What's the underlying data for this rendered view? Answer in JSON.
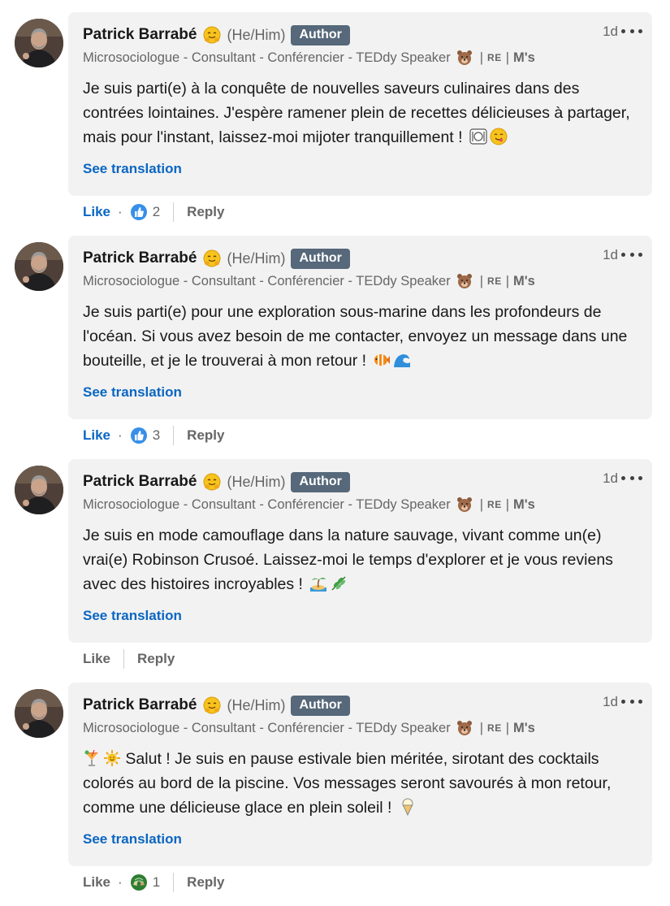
{
  "labels": {
    "author_badge": "Author",
    "see_translation": "See translation",
    "like": "Like",
    "reply": "Reply",
    "separator_dot": "·"
  },
  "colors": {
    "link_blue": "#0a66c2",
    "author_badge_bg": "#56687a",
    "bubble_bg": "#f2f2f2",
    "meta_gray": "#666666"
  },
  "comments": [
    {
      "author": "Patrick Barrabé",
      "author_emoji": "hugging-face-emoji",
      "pronouns": "(He/Him)",
      "time": "1d",
      "headline": "Microsociologue - Consultant - Conférencier - TEDdy Speaker",
      "headline_icon": "bear-face-emoji",
      "headline_tag_1": "RE",
      "headline_tag_2": "M's",
      "text": "Je suis parti(e) à la conquête de nouvelles saveurs culinaires dans des contrées lointaines. J'espère ramener plein de recettes délicieuses à partager, mais pour l'instant, laissez-moi mijoter tranquillement !",
      "text_emojis": [
        "plate-cutlery-emoji",
        "yum-face-emoji"
      ],
      "liked": true,
      "reaction_icon": "like-thumb-icon",
      "reaction_count": "2"
    },
    {
      "author": "Patrick Barrabé",
      "author_emoji": "hugging-face-emoji",
      "pronouns": "(He/Him)",
      "time": "1d",
      "headline": "Microsociologue - Consultant - Conférencier - TEDdy Speaker",
      "headline_icon": "bear-face-emoji",
      "headline_tag_1": "RE",
      "headline_tag_2": "M's",
      "text": "Je suis parti(e) pour une exploration sous-marine dans les profondeurs de l'océan. Si vous avez besoin de me contacter, envoyez un message dans une bouteille, et je le trouverai à mon retour !",
      "text_emojis": [
        "tropical-fish-emoji",
        "wave-emoji"
      ],
      "liked": true,
      "reaction_icon": "like-thumb-icon",
      "reaction_count": "3"
    },
    {
      "author": "Patrick Barrabé",
      "author_emoji": "hugging-face-emoji",
      "pronouns": "(He/Him)",
      "time": "1d",
      "headline": "Microsociologue - Consultant - Conférencier - TEDdy Speaker",
      "headline_icon": "bear-face-emoji",
      "headline_tag_1": "RE",
      "headline_tag_2": "M's",
      "text": "Je suis en mode camouflage dans la nature sauvage, vivant comme un(e) vrai(e) Robinson Crusoé. Laissez-moi le temps d'explorer et je vous reviens avec des histoires incroyables !",
      "text_emojis": [
        "desert-island-emoji",
        "herb-emoji"
      ],
      "liked": false,
      "reaction_icon": "",
      "reaction_count": ""
    },
    {
      "author": "Patrick Barrabé",
      "author_emoji": "hugging-face-emoji",
      "pronouns": "(He/Him)",
      "time": "1d",
      "headline": "Microsociologue - Consultant - Conférencier - TEDdy Speaker",
      "headline_icon": "bear-face-emoji",
      "headline_tag_1": "RE",
      "headline_tag_2": "M's",
      "text_prefix_emojis": [
        "tropical-drink-emoji",
        "sun-emoji"
      ],
      "text": "Salut ! Je suis en pause estivale bien méritée, sirotant des cocktails colorés au bord de la piscine. Vos messages seront savourés à mon retour, comme une délicieuse glace en plein soleil !",
      "text_emojis": [
        "ice-cream-emoji"
      ],
      "liked": false,
      "reaction_icon": "support-hands-icon",
      "reaction_count": "1"
    }
  ]
}
